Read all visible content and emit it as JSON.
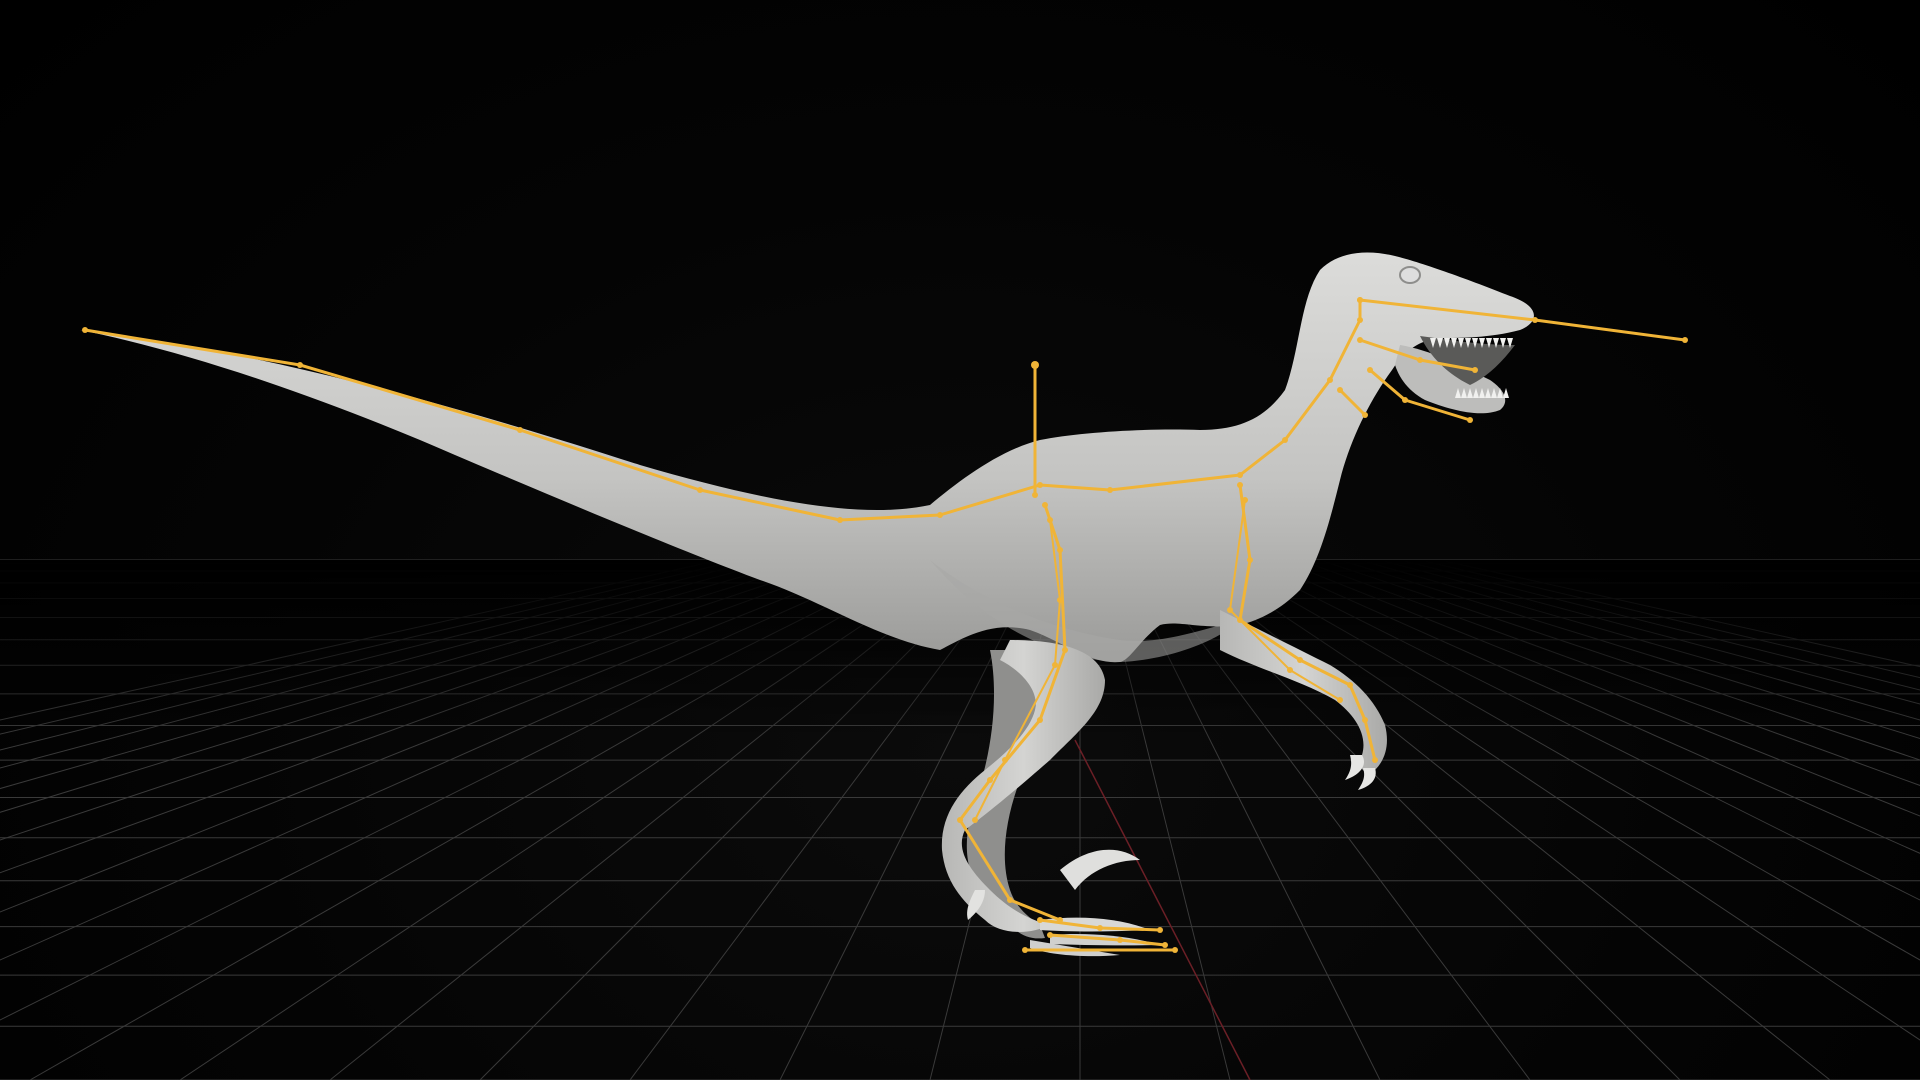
{
  "viewport": {
    "mode": "3d-viewport",
    "background_color": "#000000",
    "grid_color": "#3a3a3a",
    "axis_color": "#6b1f26",
    "model": {
      "subject": "raptor-dinosaur",
      "shading": "solid",
      "mesh_color": "#c9c9c7"
    },
    "armature": {
      "bone_color": "#f0b437",
      "visible": true
    }
  }
}
